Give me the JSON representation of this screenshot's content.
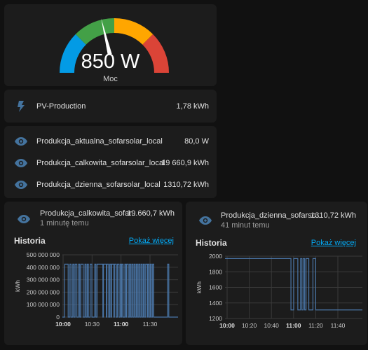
{
  "gauge": {
    "value_text": "850 W",
    "name": "Moc",
    "value": 850,
    "min": 0,
    "max": 2000,
    "segments": [
      {
        "color": "#039be5"
      },
      {
        "color": "#43a047"
      },
      {
        "color": "#ffa600"
      },
      {
        "color": "#db4437"
      }
    ]
  },
  "pv_card": {
    "icon": "flash-icon",
    "name": "PV-Production",
    "value": "1,78 kWh"
  },
  "entities": [
    {
      "icon": "eye-icon",
      "name": "Produkcja_aktualna_sofarsolar_local",
      "value": "80,0 W"
    },
    {
      "icon": "eye-icon",
      "name": "Produkcja_calkowita_sofarsolar_local",
      "value": "19 660,9 kWh"
    },
    {
      "icon": "eye-icon",
      "name": "Produkcja_dzienna_sofarsolar_local",
      "value": "1310,72 kWh"
    }
  ],
  "graph_cards": [
    {
      "icon": "eye-icon",
      "title": "Produkcja_calkowita_sofar...",
      "value": "19 660,7 kWh",
      "subtitle": "1 minutę temu",
      "history_label": "Historia",
      "more_label": "Pokaż więcej",
      "chart_data": {
        "type": "line",
        "ylabel": "kWh",
        "y_ticks": [
          "500 000 000",
          "400 000 000",
          "300 000 000",
          "200 000 000",
          "100 000 000",
          "0"
        ],
        "x_ticks": [
          {
            "label": "10:00",
            "bold": true
          },
          {
            "label": "10:30",
            "bold": false
          },
          {
            "label": "11:00",
            "bold": true
          },
          {
            "label": "11:30",
            "bold": false
          }
        ],
        "ylim": [
          0,
          500000000
        ],
        "high_value": 425000000,
        "low_value": 0,
        "high_intervals_min": [
          [
            0,
            3
          ],
          [
            4.5,
            5.5
          ],
          [
            7,
            8
          ],
          [
            9,
            10.5
          ],
          [
            12,
            13
          ],
          [
            14,
            16
          ],
          [
            17.5,
            18.5
          ],
          [
            19.5,
            20.5
          ],
          [
            22,
            23.5
          ],
          [
            26,
            27
          ],
          [
            28,
            33
          ],
          [
            33.5,
            36
          ],
          [
            36.5,
            38
          ],
          [
            39,
            40
          ],
          [
            40.5,
            42.5
          ],
          [
            43,
            44.5
          ],
          [
            45.5,
            47
          ],
          [
            48,
            49
          ],
          [
            49.5,
            50.5
          ],
          [
            52,
            53
          ],
          [
            53.5,
            55
          ],
          [
            56,
            57
          ],
          [
            58,
            59
          ],
          [
            60,
            61
          ],
          [
            62,
            63
          ],
          [
            64,
            65
          ],
          [
            66,
            67
          ],
          [
            68,
            69
          ],
          [
            70,
            71.5
          ],
          [
            72,
            73
          ],
          [
            74,
            75
          ],
          [
            76,
            77
          ],
          [
            89,
            90
          ]
        ],
        "x_range_min": [
          -2,
          98
        ],
        "grid": true,
        "line_color": "#4a76a8"
      }
    },
    {
      "icon": "eye-icon",
      "title": "Produkcja_dzienna_sofarso...",
      "value": "1310,72 kWh",
      "subtitle": "41 minut temu",
      "history_label": "Historia",
      "more_label": "Pokaż więcej",
      "chart_data": {
        "type": "line",
        "ylabel": "kWh",
        "y_ticks": [
          "2000",
          "1800",
          "1600",
          "1400",
          "1200"
        ],
        "x_ticks": [
          {
            "label": "10:00",
            "bold": true
          },
          {
            "label": "10:20",
            "bold": false
          },
          {
            "label": "10:40",
            "bold": false
          },
          {
            "label": "11:00",
            "bold": true
          },
          {
            "label": "11:20",
            "bold": false
          },
          {
            "label": "11:40",
            "bold": false
          }
        ],
        "ylim": [
          1200,
          2000
        ],
        "high_value": 1970,
        "low_value": 1310,
        "x_range_min": [
          0,
          100
        ],
        "steps": [
          [
            0,
            1970
          ],
          [
            48,
            1310
          ],
          [
            50,
            1970
          ],
          [
            53,
            1310
          ],
          [
            55,
            1970
          ],
          [
            56,
            1310
          ],
          [
            57,
            1970
          ],
          [
            58,
            1310
          ],
          [
            59,
            1970
          ],
          [
            61,
            1310
          ],
          [
            64,
            1970
          ],
          [
            66,
            1310
          ],
          [
            100,
            1310
          ]
        ],
        "grid": true,
        "line_color": "#4a76a8"
      }
    }
  ]
}
